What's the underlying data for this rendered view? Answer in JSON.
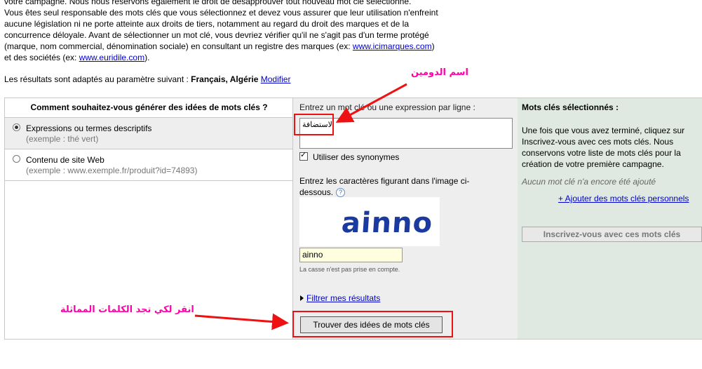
{
  "intro": {
    "line1": "votre campagne. Nous nous réservons également le droit de désapprouver tout nouveau mot clé sélectionné.",
    "line2": "Vous êtes seul responsable des mots clés que vous sélectionnez et devez vous assurer que leur utilisation n'enfreint",
    "line3": "aucune législation ni ne porte atteinte aux droits de tiers, notamment au regard du droit des marques et de la",
    "line4": "concurrence déloyale. Avant de sélectionner un mot clé, vous devriez vérifier qu'il ne s'agit pas d'un terme protégé",
    "line5_pre": "(marque, nom commercial, dénomination sociale) en consultant un registre des marques (ex: ",
    "link1": "www.icimarques.com",
    "line5_post": ")",
    "line6_pre": "et des sociétés (ex: ",
    "link2": "www.euridile.com",
    "line6_post": ")."
  },
  "results": {
    "prefix": "Les résultats sont adaptés au paramètre suivant : ",
    "value": "Français, Algérie",
    "modify_link": "Modifier"
  },
  "left_panel": {
    "header": "Comment souhaitez-vous générer des idées de mots clés ?",
    "options": [
      {
        "label": "Expressions ou termes descriptifs",
        "example": "(exemple : thé vert)"
      },
      {
        "label": "Contenu de site Web",
        "example": "(exemple : www.exemple.fr/produit?id=74893)"
      }
    ]
  },
  "middle_panel": {
    "label": "Entrez un mot clé ou une expression par ligne :",
    "keyword_value": "الاستضافة",
    "synonyms_label": "Utiliser des synonymes",
    "captcha_label": "Entrez les caractères figurant dans l'image ci-dessous.",
    "help_icon_text": "?",
    "captcha_image_text": "ainno",
    "captcha_input_value": "ainno",
    "case_note": "La casse n'est pas prise en compte.",
    "filter_link": "Filtrer mes résultats",
    "find_button": "Trouver des idées de mots clés"
  },
  "right_panel": {
    "header": "Mots clés sélectionnés :",
    "description": "Une fois que vous avez terminé, cliquez sur Inscrivez-vous avec ces mots clés. Nous conservons votre liste de mots clés pour la création de votre première campagne.",
    "no_keyword": "Aucun mot clé n'a encore été ajouté",
    "add_link": "+ Ajouter des mots clés personnels",
    "signup_button": "Inscrivez-vous avec ces mots clés"
  },
  "annotations": {
    "domain_name": "اسم الدومين",
    "click_hint": "انقر لكي تجد الكلمات المماثلة"
  },
  "colors": {
    "annotation": "#ff00aa",
    "highlight": "#ee1111",
    "link": "#0000cc",
    "selected_panel": "#dfe9e1"
  }
}
